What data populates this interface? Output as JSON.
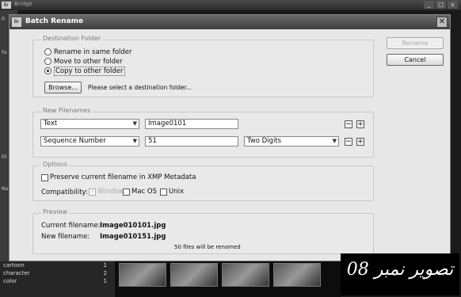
{
  "app": {
    "title": "Bridge",
    "logo": "Br",
    "win_min": "_",
    "win_max": "□",
    "win_close": "x",
    "left_labels": [
      "Fi",
      "Fa",
      "Fil",
      "Na"
    ],
    "list_rows": [
      {
        "name": "cartoon",
        "count": "1"
      },
      {
        "name": "character",
        "count": "2"
      },
      {
        "name": "color",
        "count": "1"
      }
    ]
  },
  "dialog": {
    "title": "Batch Rename",
    "close_glyph": "✕",
    "buttons": {
      "rename": "Rename",
      "cancel": "Cancel"
    },
    "destination": {
      "legend": "Destination Folder",
      "options": [
        "Rename in same folder",
        "Move to other folder",
        "Copy to other folder"
      ],
      "selected": 2,
      "browse": "Browse...",
      "hint": "Please select a destination folder..."
    },
    "new_filenames": {
      "legend": "New Filenames",
      "rows": [
        {
          "type": "Text",
          "value": "Image0101",
          "extra": ""
        },
        {
          "type": "Sequence Number",
          "value": "51",
          "extra": "Two Digits"
        }
      ],
      "minus": "−",
      "plus": "+"
    },
    "options": {
      "legend": "Options",
      "preserve": "Preserve current filename in XMP Metadata",
      "compat_label": "Compatibility:",
      "windows": "Windows",
      "macos": "Mac OS",
      "unix": "Unix",
      "windows_checked": true
    },
    "preview": {
      "legend": "Preview",
      "current_label": "Current filename:",
      "current_value": "Image010101.jpg",
      "new_label": "New filename:",
      "new_value": "Image010151.jpg",
      "count_note": "50 files will be renamed"
    }
  },
  "caption": {
    "text": "تصویر نمبر 08"
  }
}
